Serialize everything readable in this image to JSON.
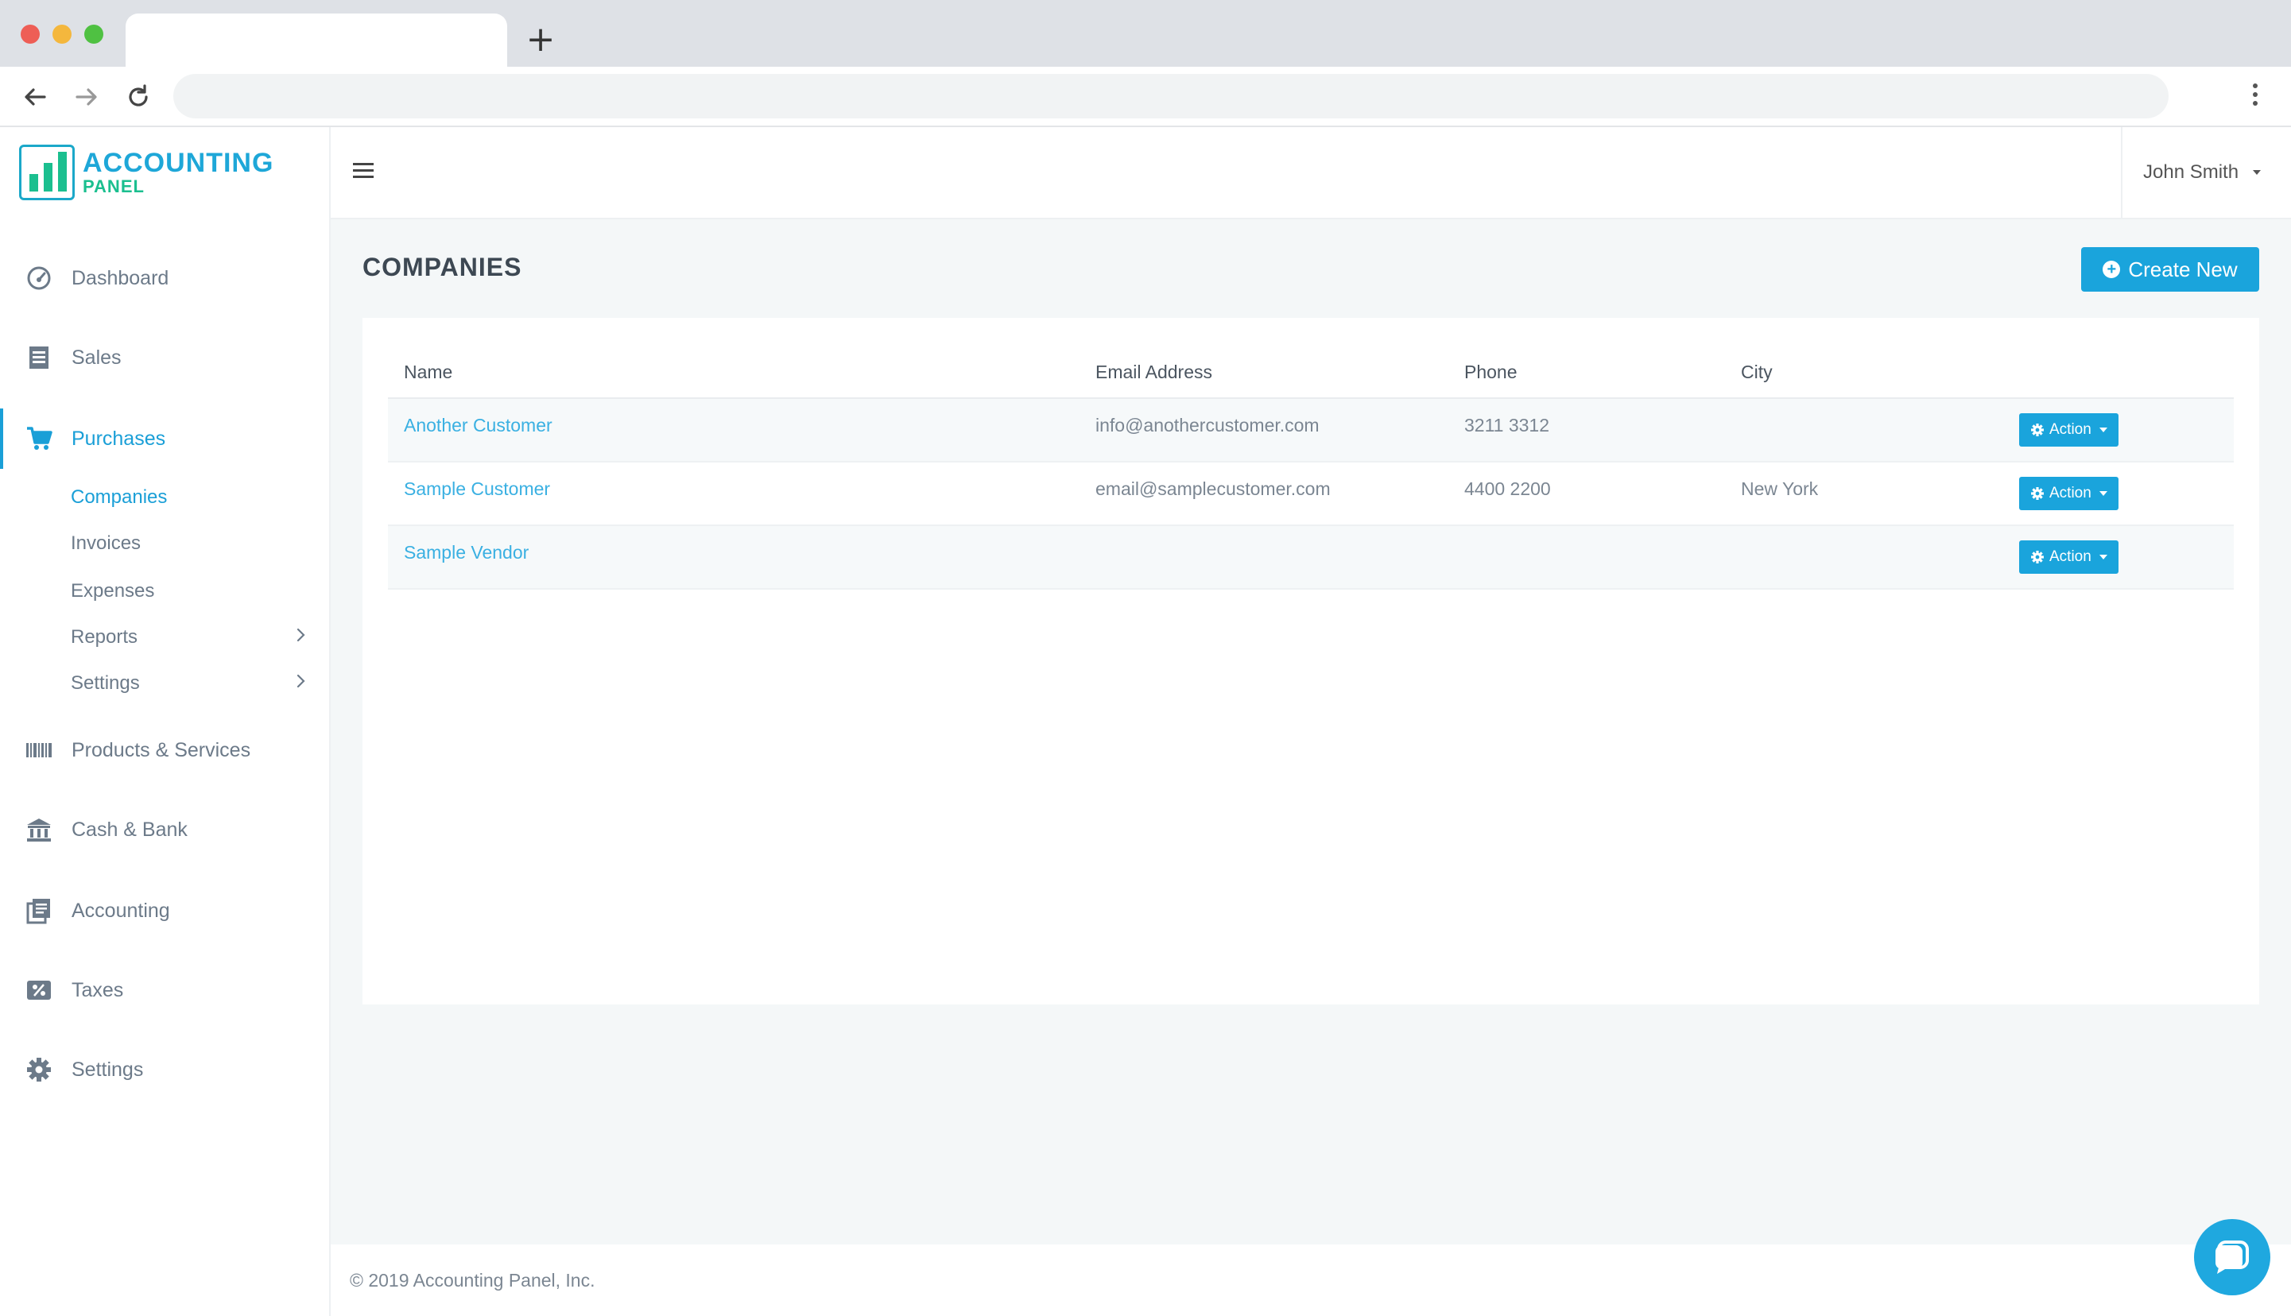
{
  "browser": {
    "tab_title": "",
    "url": "",
    "new_tab_label": "+"
  },
  "app": {
    "logo_line1": "ACCOUNTING",
    "logo_line2": "PANEL",
    "brand_color": "#1aa4dc"
  },
  "sidebar": {
    "items": [
      {
        "label": "Dashboard",
        "icon": "speedometer-icon"
      },
      {
        "label": "Sales",
        "icon": "receipt-icon"
      },
      {
        "label": "Purchases",
        "icon": "cart-icon",
        "active": true
      },
      {
        "label": "Products & Services",
        "icon": "barcode-icon"
      },
      {
        "label": "Cash & Bank",
        "icon": "bank-icon"
      },
      {
        "label": "Accounting",
        "icon": "ledger-icon"
      },
      {
        "label": "Taxes",
        "icon": "percent-icon"
      },
      {
        "label": "Settings",
        "icon": "gear-icon"
      }
    ],
    "purchases_sub": [
      {
        "label": "Companies",
        "active": true
      },
      {
        "label": "Invoices"
      },
      {
        "label": "Expenses"
      },
      {
        "label": "Reports"
      },
      {
        "label": "Settings"
      }
    ]
  },
  "header": {
    "user_name": "John Smith"
  },
  "main": {
    "title": "COMPANIES",
    "create_button": "Create New",
    "table": {
      "columns": [
        "Name",
        "Email Address",
        "Phone",
        "City"
      ],
      "rows": [
        {
          "name": "Another Customer",
          "email": "info@anothercustomer.com",
          "phone": "3211 3312",
          "city": "",
          "action": "Action"
        },
        {
          "name": "Sample Customer",
          "email": "email@samplecustomer.com",
          "phone": "4400 2200",
          "city": "New York",
          "action": "Action"
        },
        {
          "name": "Sample Vendor",
          "email": "",
          "phone": "",
          "city": "",
          "action": "Action"
        }
      ]
    }
  },
  "footer": {
    "copyright": "© 2019 Accounting Panel, Inc."
  }
}
